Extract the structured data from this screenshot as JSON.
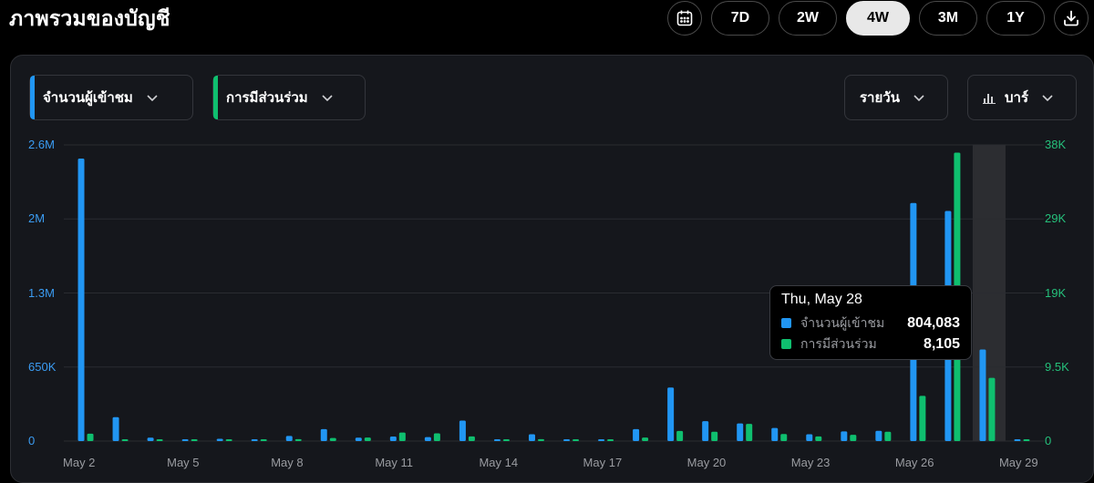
{
  "header": {
    "title": "ภาพรวมของบัญชี",
    "ranges": [
      "7D",
      "2W",
      "4W",
      "3M",
      "1Y"
    ],
    "active_range": "4W"
  },
  "filters": {
    "metric1": "จำนวนผู้เข้าชม",
    "metric2": "การมีส่วนร่วม",
    "interval": "รายวัน",
    "chart_type": "บาร์"
  },
  "colors": {
    "views": "#2196f3",
    "engagement": "#0fbf6f",
    "highlight": "#2c2d31"
  },
  "chart_data": {
    "type": "bar",
    "categories": [
      "May 2",
      "May 3",
      "May 4",
      "May 5",
      "May 6",
      "May 7",
      "May 8",
      "May 9",
      "May 10",
      "May 11",
      "May 12",
      "May 13",
      "May 14",
      "May 15",
      "May 16",
      "May 17",
      "May 18",
      "May 19",
      "May 20",
      "May 21",
      "May 22",
      "May 23",
      "May 24",
      "May 25",
      "May 26",
      "May 27",
      "May 28",
      "May 29"
    ],
    "x_tick_labels": [
      "May 2",
      "May 5",
      "May 8",
      "May 11",
      "May 14",
      "May 17",
      "May 20",
      "May 23",
      "May 26",
      "May 29"
    ],
    "left_axis": {
      "ticks": [
        {
          "v": 0,
          "label": "0"
        },
        {
          "v": 650000,
          "label": "650K"
        },
        {
          "v": 1300000,
          "label": "1.3M"
        },
        {
          "v": 1950000,
          "label": "2M"
        },
        {
          "v": 2600000,
          "label": "2.6M"
        }
      ],
      "max": 2600000
    },
    "right_axis": {
      "ticks": [
        {
          "v": 0,
          "label": "0"
        },
        {
          "v": 9500,
          "label": "9.5K"
        },
        {
          "v": 19000,
          "label": "19K"
        },
        {
          "v": 28500,
          "label": "29K"
        },
        {
          "v": 38000,
          "label": "38K"
        }
      ],
      "max": 38000
    },
    "series": [
      {
        "name": "จำนวนผู้เข้าชม",
        "axis": "left",
        "values": [
          2480000,
          210000,
          30000,
          15000,
          20000,
          15000,
          45000,
          105000,
          30000,
          40000,
          35000,
          180000,
          12000,
          60000,
          15000,
          8000,
          105000,
          470000,
          175000,
          155000,
          115000,
          60000,
          85000,
          90000,
          2090000,
          2020000,
          804083,
          15000
        ]
      },
      {
        "name": "การมีส่วนร่วม",
        "axis": "right",
        "values": [
          950,
          120,
          100,
          100,
          100,
          100,
          250,
          400,
          450,
          1100,
          1000,
          600,
          150,
          250,
          130,
          80,
          450,
          1300,
          1200,
          2200,
          900,
          600,
          800,
          1200,
          5800,
          37000,
          8105,
          120
        ]
      }
    ],
    "highlighted_category": "May 28",
    "ylim_left": [
      0,
      2600000
    ],
    "ylim_right": [
      0,
      38000
    ],
    "grid": true
  },
  "tooltip": {
    "date": "Thu, May 28",
    "rows": [
      {
        "label": "จำนวนผู้เข้าชม",
        "value": "804,083"
      },
      {
        "label": "การมีส่วนร่วม",
        "value": "8,105"
      }
    ]
  }
}
